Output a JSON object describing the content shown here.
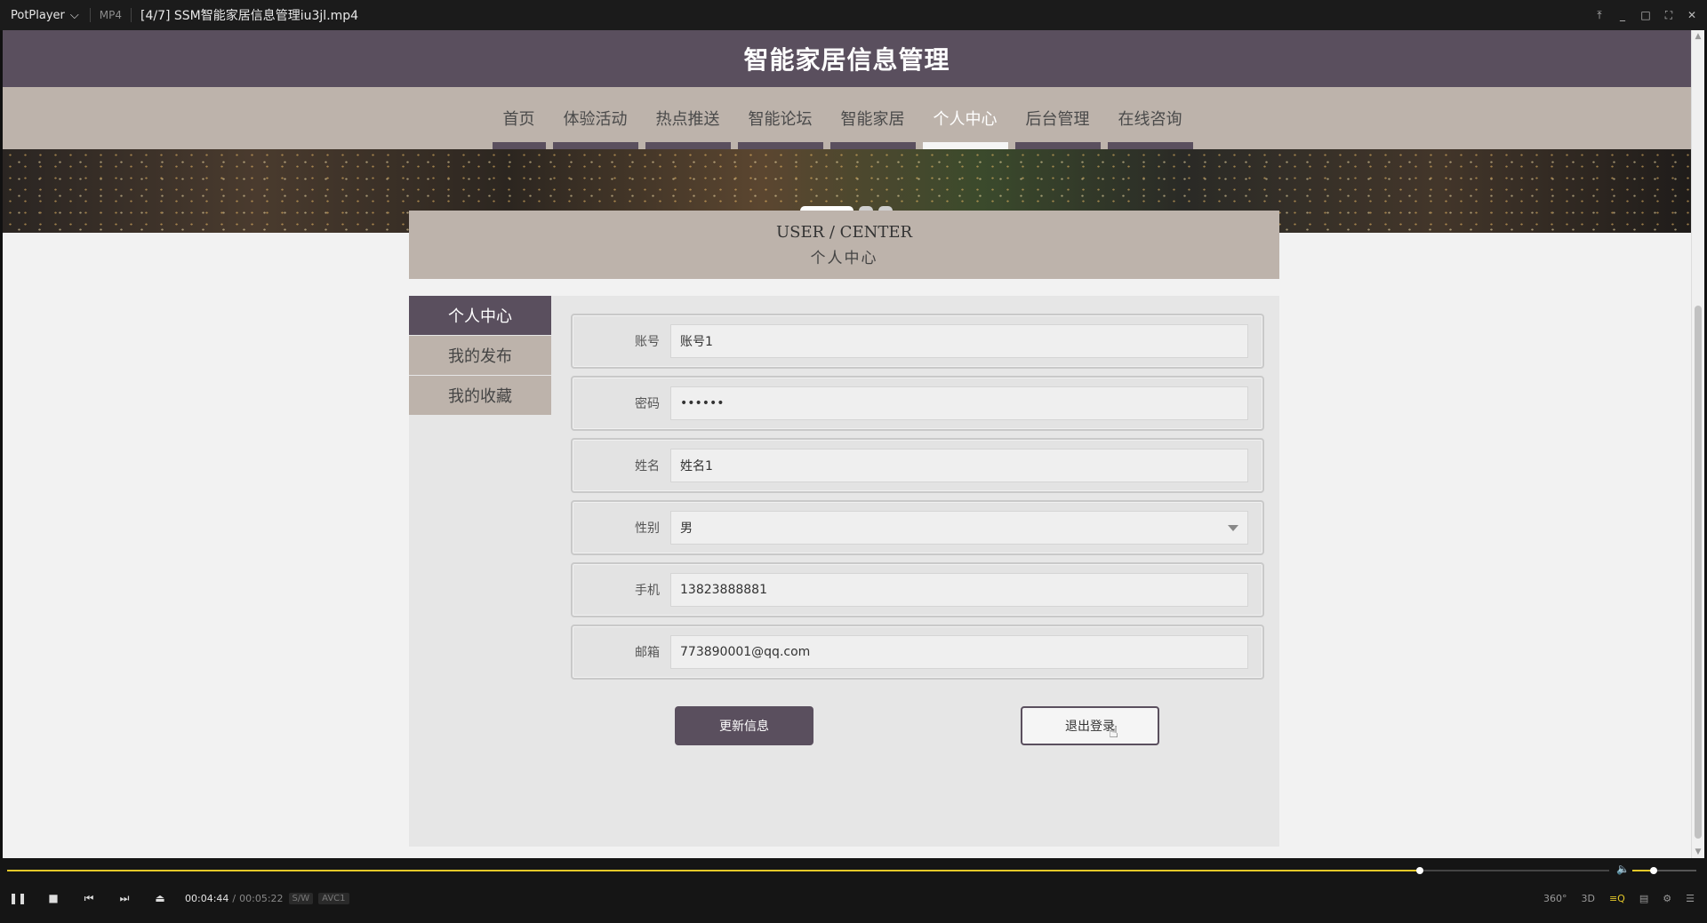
{
  "player": {
    "brand": "PotPlayer",
    "brand_chevron": "⌵",
    "format": "MP4",
    "file_title": "[4/7] SSM智能家居信息管理iu3jl.mp4",
    "controls": {
      "pin": "⤒",
      "minimize": "_",
      "maximize": "□",
      "fullscreen": "⛶",
      "close": "✕"
    },
    "time_current": "00:04:44",
    "time_sep": "/",
    "time_total": "00:05:22",
    "badge_sw": "S/W",
    "badge_codec": "AVC1",
    "progress": 0.882,
    "volume": 0.33,
    "right_controls": [
      "360°",
      "3D",
      "≡Q",
      "▤",
      "⚙",
      "☰"
    ],
    "accent_color": "#e3c829"
  },
  "site": {
    "header_title": "智能家居信息管理",
    "nav": [
      "首页",
      "体验活动",
      "热点推送",
      "智能论坛",
      "智能家居",
      "个人中心",
      "后台管理",
      "在线咨询"
    ],
    "nav_active_index": 5,
    "banner_slide_count": 3,
    "banner_active_index": 0,
    "center_en": "USER / CENTER",
    "center_cn": "个人中心",
    "side_menu": [
      "个人中心",
      "我的发布",
      "我的收藏"
    ],
    "side_active_index": 0,
    "form": {
      "account_label": "账号",
      "account_value": "账号1",
      "password_label": "密码",
      "password_value": "••••••",
      "name_label": "姓名",
      "name_value": "姓名1",
      "gender_label": "性别",
      "gender_value": "男",
      "phone_label": "手机",
      "phone_value": "13823888881",
      "email_label": "邮箱",
      "email_value": "773890001@qq.com"
    },
    "update_button": "更新信息",
    "logout_button": "退出登录",
    "colors": {
      "primary": "#5a4f5e",
      "secondary": "#bdb3ab"
    }
  }
}
